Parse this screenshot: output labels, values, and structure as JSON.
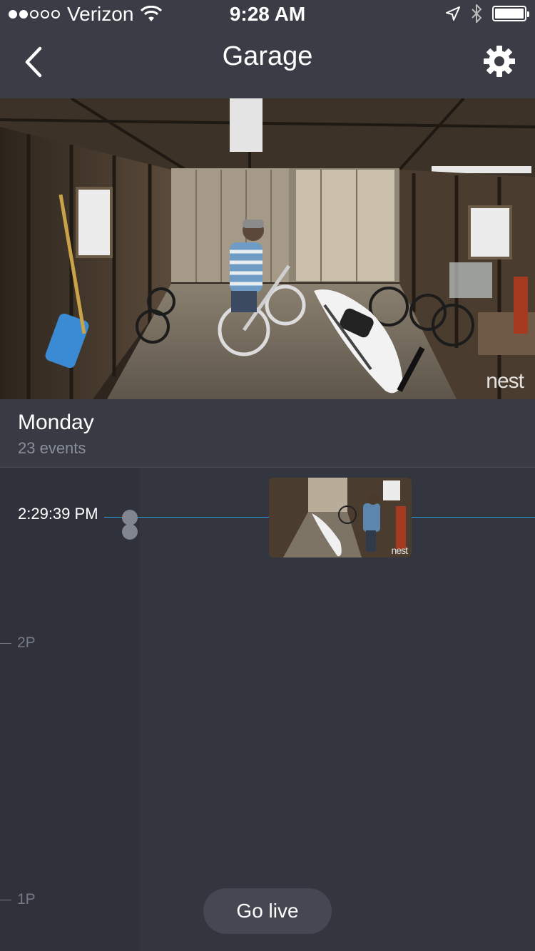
{
  "status_bar": {
    "carrier": "Verizon",
    "time": "9:28 AM",
    "signal_filled": 2,
    "signal_total": 5
  },
  "nav": {
    "title": "Garage",
    "back_icon": "chevron-left-icon",
    "settings_icon": "gear-icon"
  },
  "camera": {
    "watermark": "nest"
  },
  "day_section": {
    "day": "Monday",
    "event_count": "23 events"
  },
  "timeline": {
    "current_time": "2:29:39 PM",
    "ticks": [
      "2P",
      "1P"
    ],
    "thumbnail_watermark": "nest"
  },
  "actions": {
    "go_live": "Go live"
  },
  "colors": {
    "background": "#33363f",
    "header": "#3a3d45",
    "accent_line": "#2aa3e6"
  }
}
